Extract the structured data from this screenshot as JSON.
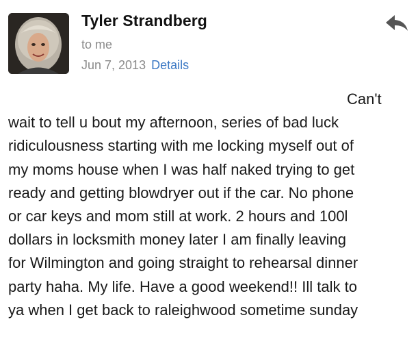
{
  "sender": {
    "name": "Tyler Strandberg"
  },
  "recipient_label": "to me",
  "date": "Jun 7, 2013",
  "details_label": "Details",
  "icons": {
    "avatar": "sender-photo",
    "reply": "reply-arrow-icon"
  },
  "colors": {
    "link": "#3b78c4",
    "secondary_text": "#8a8a8a",
    "reply_icon": "#555555"
  },
  "message_lines": [
    "Can't",
    "wait to tell u bout my afternoon, series of bad luck",
    "ridiculousness starting with me locking myself out of",
    "my moms house when I was half naked trying to get",
    "ready and getting blowdryer out if the car. No phone",
    "or car keys and mom still at work. 2 hours and 100l",
    "dollars in locksmith money later I am finally leaving",
    "for Wilmington and going straight to rehearsal dinner",
    "party haha. My life. Have a good weekend!! Ill talk to",
    "ya when I get back to raleighwood sometime sunday"
  ]
}
